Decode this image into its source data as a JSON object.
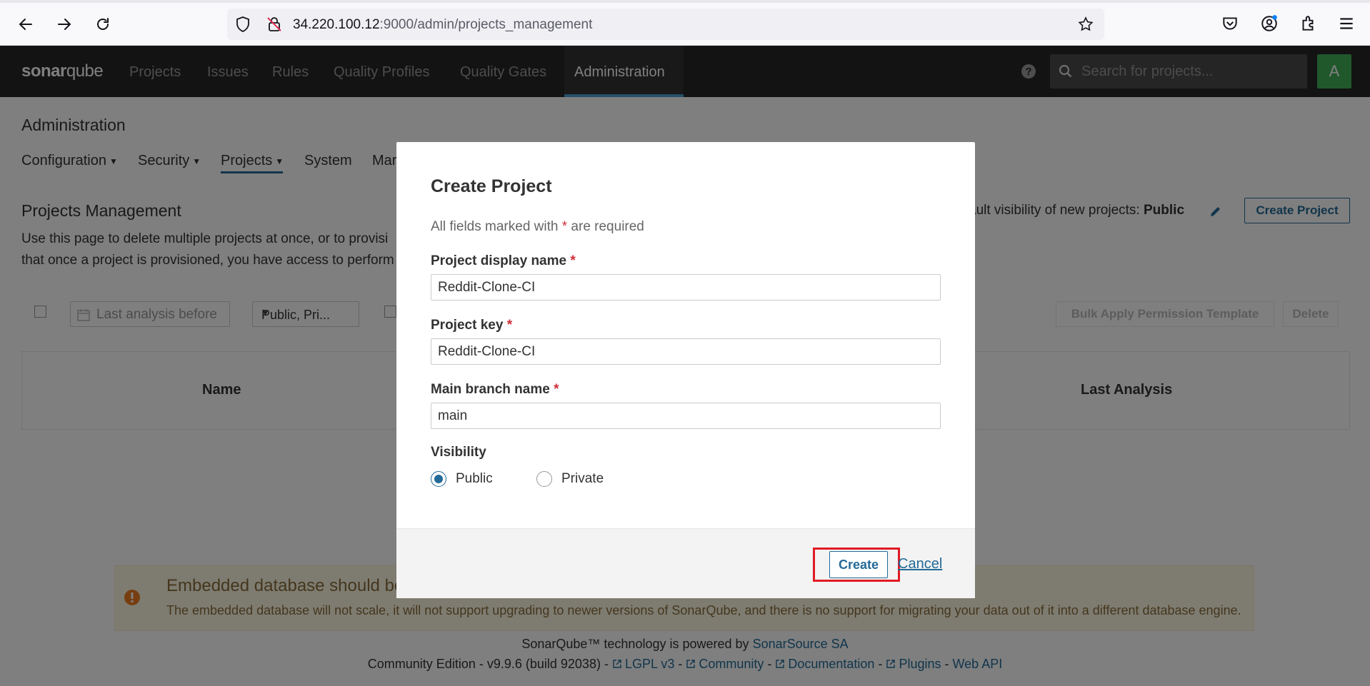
{
  "browser": {
    "url_host": "34.220.100.12",
    "url_path": ":9000/admin/projects_management"
  },
  "sonar": {
    "logo_bold": "sonar",
    "logo_light": "qube",
    "nav": [
      "Projects",
      "Issues",
      "Rules",
      "Quality Profiles",
      "Quality Gates",
      "Administration"
    ],
    "search_placeholder": "Search for projects...",
    "avatar_letter": "A"
  },
  "admin": {
    "title": "Administration",
    "tabs": [
      "Configuration",
      "Security",
      "Projects",
      "System",
      "Mar"
    ]
  },
  "projects_management": {
    "title": "Projects Management",
    "desc_line1": "Use this page to delete multiple projects at once, or to provisi",
    "desc_line2": "that once a project is provisioned, you have access to perform",
    "default_visibility_label": "ault visibility of new projects:",
    "default_visibility_value": "Public",
    "create_project_label": "Create Project",
    "date_filter_placeholder": "Last analysis before",
    "visibility_filter": "Public, Pri...",
    "bulk_apply_label": "Bulk Apply Permission Template",
    "delete_label": "Delete",
    "col_name": "Name",
    "col_last_analysis": "Last Analysis"
  },
  "warning": {
    "title": "Embedded database should be",
    "text": "The embedded database will not scale, it will not support upgrading to newer versions of SonarQube, and there is no support for migrating your data out of it into a different database engine."
  },
  "footer": {
    "powered_prefix": "SonarQube™ technology is powered by",
    "powered_link": "SonarSource SA",
    "edition": "Community Edition - v9.9.6 (build 92038) -",
    "links": [
      "LGPL v3",
      "Community",
      "Documentation",
      "Plugins"
    ],
    "web_api": "Web API"
  },
  "modal": {
    "title": "Create Project",
    "required_note_pre": "All fields marked with",
    "required_star": "*",
    "required_note_post": "are required",
    "display_name_label": "Project display name",
    "display_name_value": "Reddit-Clone-CI",
    "key_label": "Project key",
    "key_value": "Reddit-Clone-CI",
    "branch_label": "Main branch name",
    "branch_value": "main",
    "visibility_label": "Visibility",
    "visibility_options": [
      "Public",
      "Private"
    ],
    "visibility_selected": "Public",
    "create_label": "Create",
    "cancel_label": "Cancel"
  },
  "colors": {
    "accent": "#236a97",
    "highlight": "#e01b24",
    "nav_bg": "#262626",
    "avatar": "#41b058"
  }
}
